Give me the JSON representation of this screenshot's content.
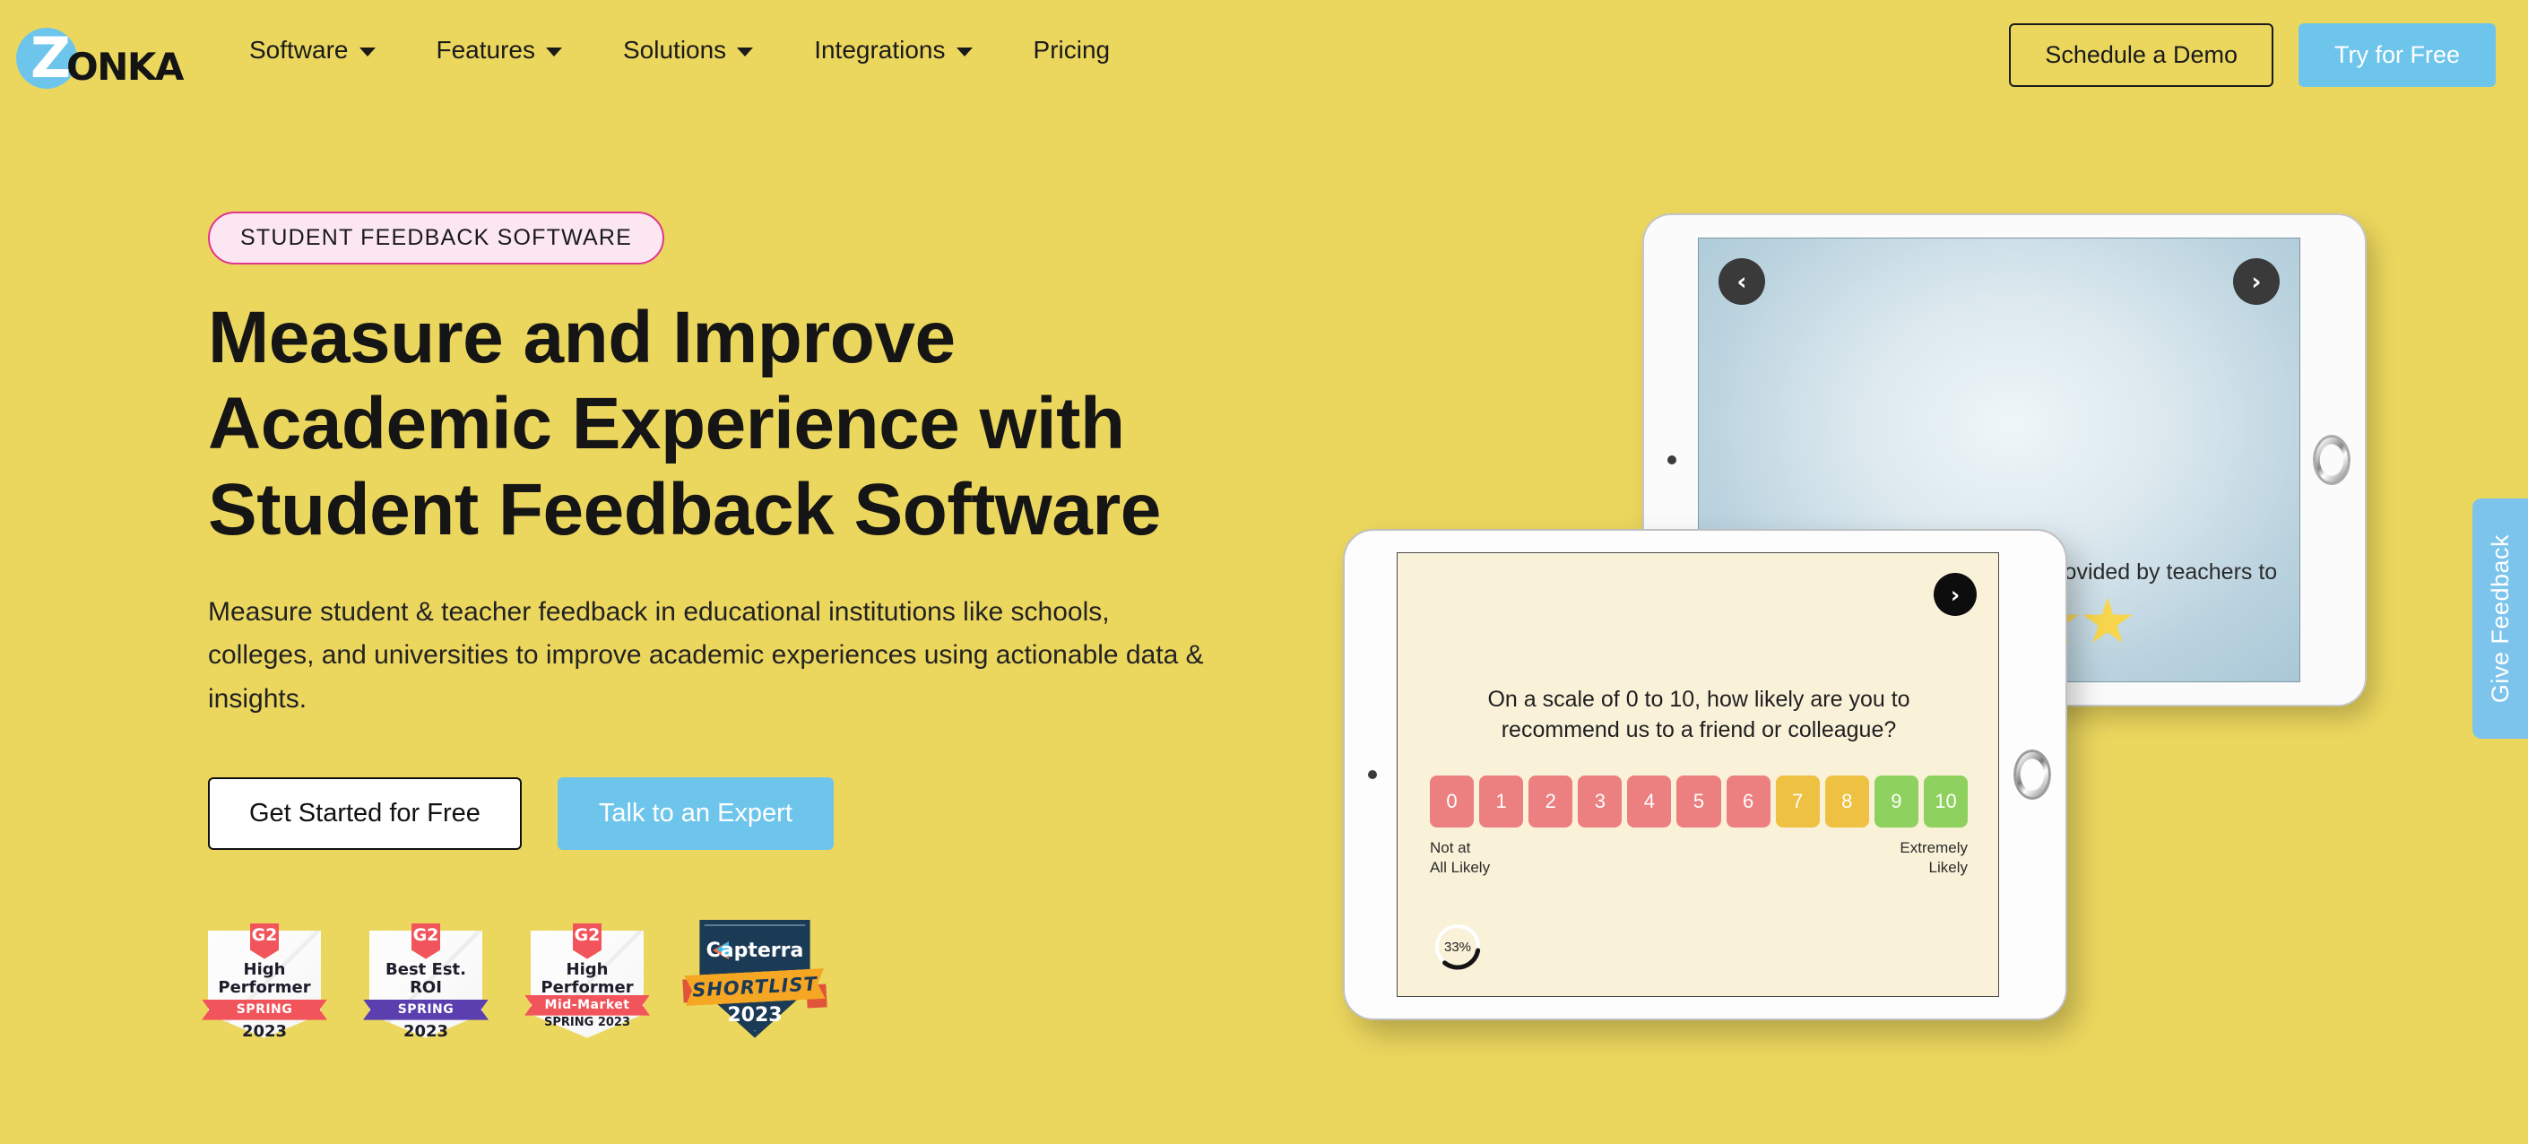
{
  "brand": {
    "logo_letter": "Z",
    "logo_word": "ONKA",
    "accent_blue": "#6ec5ec",
    "background_yellow": "#ecd75e",
    "eyebrow_border_pink": "#e0368d"
  },
  "header": {
    "nav": [
      {
        "label": "Software",
        "has_dropdown": true
      },
      {
        "label": "Features",
        "has_dropdown": true
      },
      {
        "label": "Solutions",
        "has_dropdown": true
      },
      {
        "label": "Integrations",
        "has_dropdown": true
      },
      {
        "label": "Pricing",
        "has_dropdown": false
      }
    ],
    "demo_button": "Schedule a Demo",
    "try_button": "Try for Free"
  },
  "hero": {
    "eyebrow": "STUDENT FEEDBACK SOFTWARE",
    "headline": "Measure and Improve Academic Experience with Student Feedback Software",
    "subcopy": "Measure student & teacher feedback in educational institutions like schools, colleges, and universities to improve academic experiences using actionable data & insights.",
    "primary_cta": "Get Started for Free",
    "secondary_cta": "Talk to an Expert"
  },
  "badges": [
    {
      "type": "g2",
      "logo": "G2",
      "title": "High Performer",
      "ribbon": "SPRING",
      "ribbon_color": "#f2545b",
      "year": "2023",
      "sub": ""
    },
    {
      "type": "g2",
      "logo": "G2",
      "title": "Best Est. ROI",
      "ribbon": "SPRING",
      "ribbon_color": "#5b3fae",
      "year": "2023",
      "sub": ""
    },
    {
      "type": "g2",
      "logo": "G2",
      "title": "High Performer",
      "ribbon": "Mid-Market",
      "ribbon_color": "#f2545b",
      "year": "",
      "sub": "SPRING 2023"
    },
    {
      "type": "capterra",
      "name": "Capterra",
      "ribbon": "SHORTLIST",
      "year": "2023"
    }
  ],
  "tablet_back": {
    "prev_arrow": "‹",
    "next_arrow": "›",
    "question": "How would you rate the support provided by teachers to help you?",
    "star_count": 5,
    "star_color": "#f7d64e"
  },
  "tablet_front": {
    "next_arrow": "›",
    "question": "On a scale of 0 to 10, how likely are you to recommend us to a friend or colleague?",
    "scale": [
      {
        "value": "0",
        "color": "#ec7f7f"
      },
      {
        "value": "1",
        "color": "#ec7f7f"
      },
      {
        "value": "2",
        "color": "#ec7f7f"
      },
      {
        "value": "3",
        "color": "#ec7f7f"
      },
      {
        "value": "4",
        "color": "#ec7f7f"
      },
      {
        "value": "5",
        "color": "#ec7f7f"
      },
      {
        "value": "6",
        "color": "#ec7f7f"
      },
      {
        "value": "7",
        "color": "#eec143"
      },
      {
        "value": "8",
        "color": "#eec143"
      },
      {
        "value": "9",
        "color": "#8ed15e"
      },
      {
        "value": "10",
        "color": "#8ed15e"
      }
    ],
    "label_low": "Not at\nAll Likely",
    "label_high": "Extremely\nLikely",
    "progress_label": "33%",
    "progress_value": 33
  },
  "side_tab": {
    "label": "Give Feedback"
  }
}
